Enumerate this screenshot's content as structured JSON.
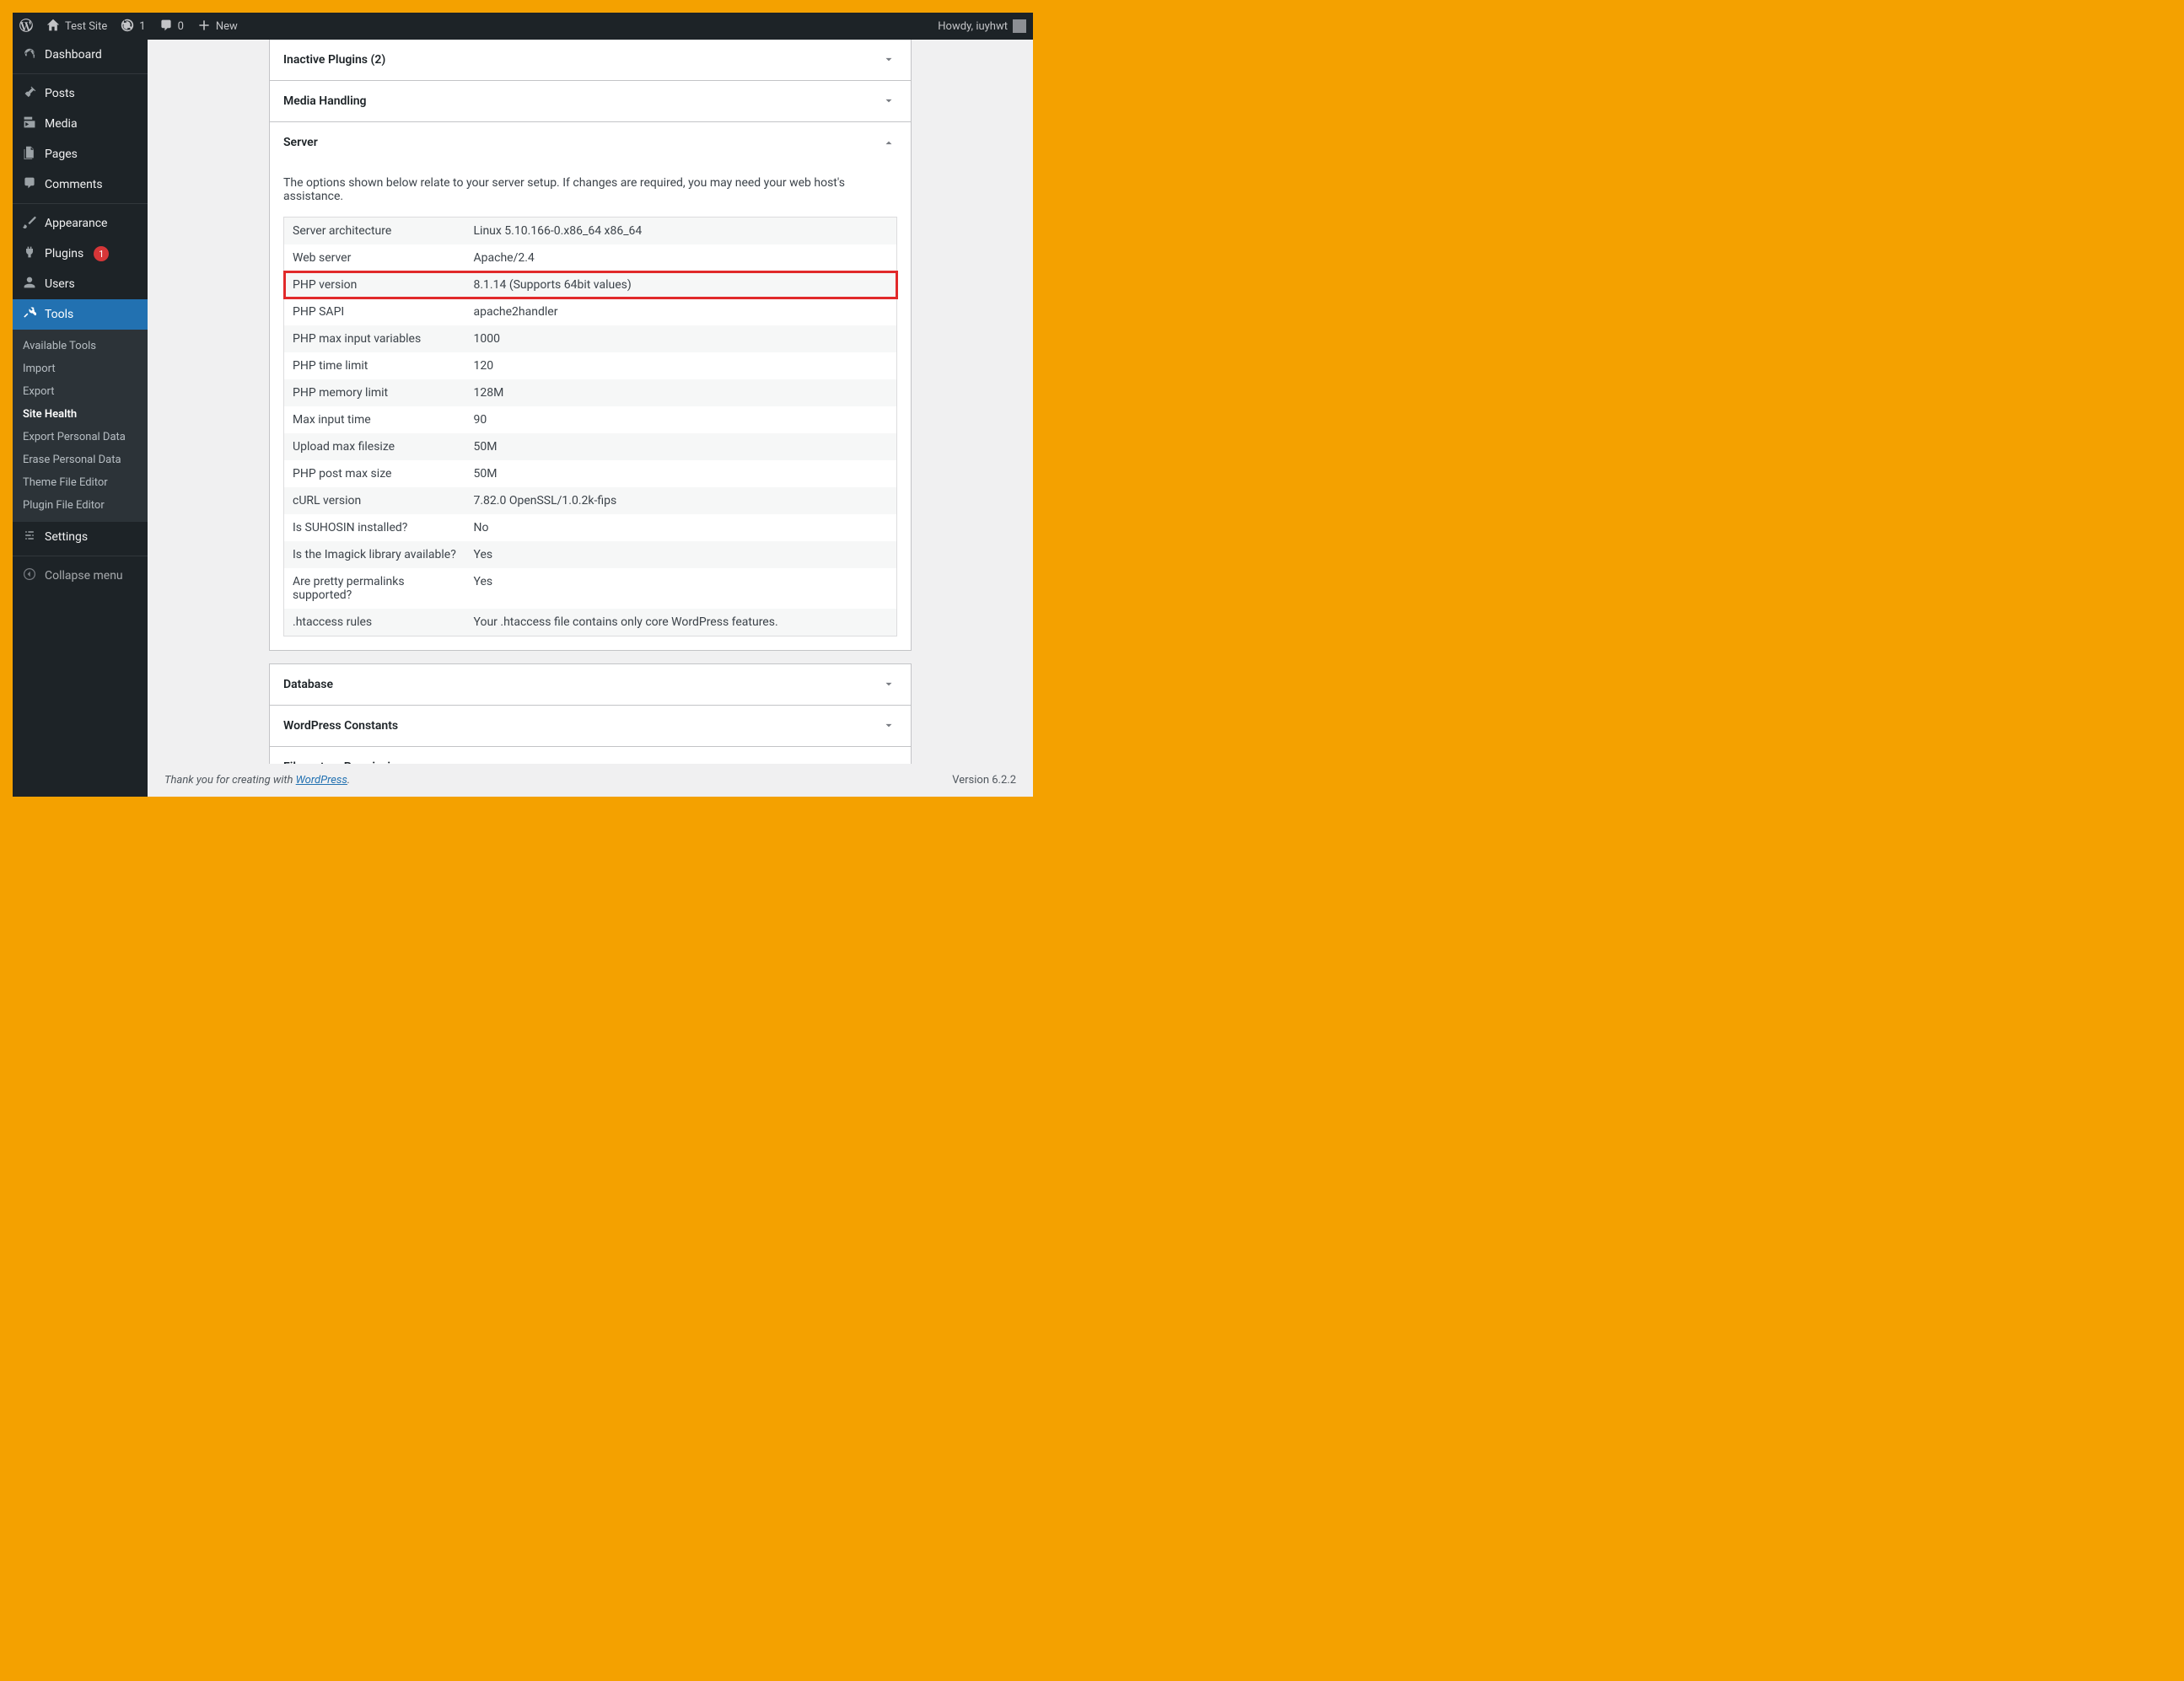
{
  "adminbar": {
    "site_name": "Test Site",
    "updates_count": "1",
    "comments_count": "0",
    "new_label": "New",
    "howdy": "Howdy, iuyhwt"
  },
  "sidebar": {
    "dashboard": "Dashboard",
    "posts": "Posts",
    "media": "Media",
    "pages": "Pages",
    "comments": "Comments",
    "appearance": "Appearance",
    "plugins": "Plugins",
    "plugins_badge": "1",
    "users": "Users",
    "tools": "Tools",
    "settings": "Settings",
    "collapse": "Collapse menu"
  },
  "submenu": {
    "available_tools": "Available Tools",
    "import": "Import",
    "export": "Export",
    "site_health": "Site Health",
    "export_personal": "Export Personal Data",
    "erase_personal": "Erase Personal Data",
    "theme_editor": "Theme File Editor",
    "plugin_editor": "Plugin File Editor"
  },
  "panels": {
    "inactive_plugins": "Inactive Plugins (2)",
    "media_handling": "Media Handling",
    "server": "Server",
    "database": "Database",
    "wp_constants": "WordPress Constants",
    "fs_permissions": "Filesystem Permissions"
  },
  "server": {
    "description": "The options shown below relate to your server setup. If changes are required, you may need your web host's assistance.",
    "rows": [
      {
        "label": "Server architecture",
        "value": "Linux 5.10.166-0.x86_64 x86_64"
      },
      {
        "label": "Web server",
        "value": "Apache/2.4"
      },
      {
        "label": "PHP version",
        "value": "8.1.14 (Supports 64bit values)"
      },
      {
        "label": "PHP SAPI",
        "value": "apache2handler"
      },
      {
        "label": "PHP max input variables",
        "value": "1000"
      },
      {
        "label": "PHP time limit",
        "value": "120"
      },
      {
        "label": "PHP memory limit",
        "value": "128M"
      },
      {
        "label": "Max input time",
        "value": "90"
      },
      {
        "label": "Upload max filesize",
        "value": "50M"
      },
      {
        "label": "PHP post max size",
        "value": "50M"
      },
      {
        "label": "cURL version",
        "value": "7.82.0 OpenSSL/1.0.2k-fips"
      },
      {
        "label": "Is SUHOSIN installed?",
        "value": "No"
      },
      {
        "label": "Is the Imagick library available?",
        "value": "Yes"
      },
      {
        "label": "Are pretty permalinks supported?",
        "value": "Yes"
      },
      {
        "label": ".htaccess rules",
        "value": "Your .htaccess file contains only core WordPress features."
      }
    ],
    "highlighted_row_index": 2
  },
  "footer": {
    "thanks_prefix": "Thank you for creating with ",
    "wordpress": "WordPress",
    "thanks_suffix": ".",
    "version": "Version 6.2.2"
  }
}
